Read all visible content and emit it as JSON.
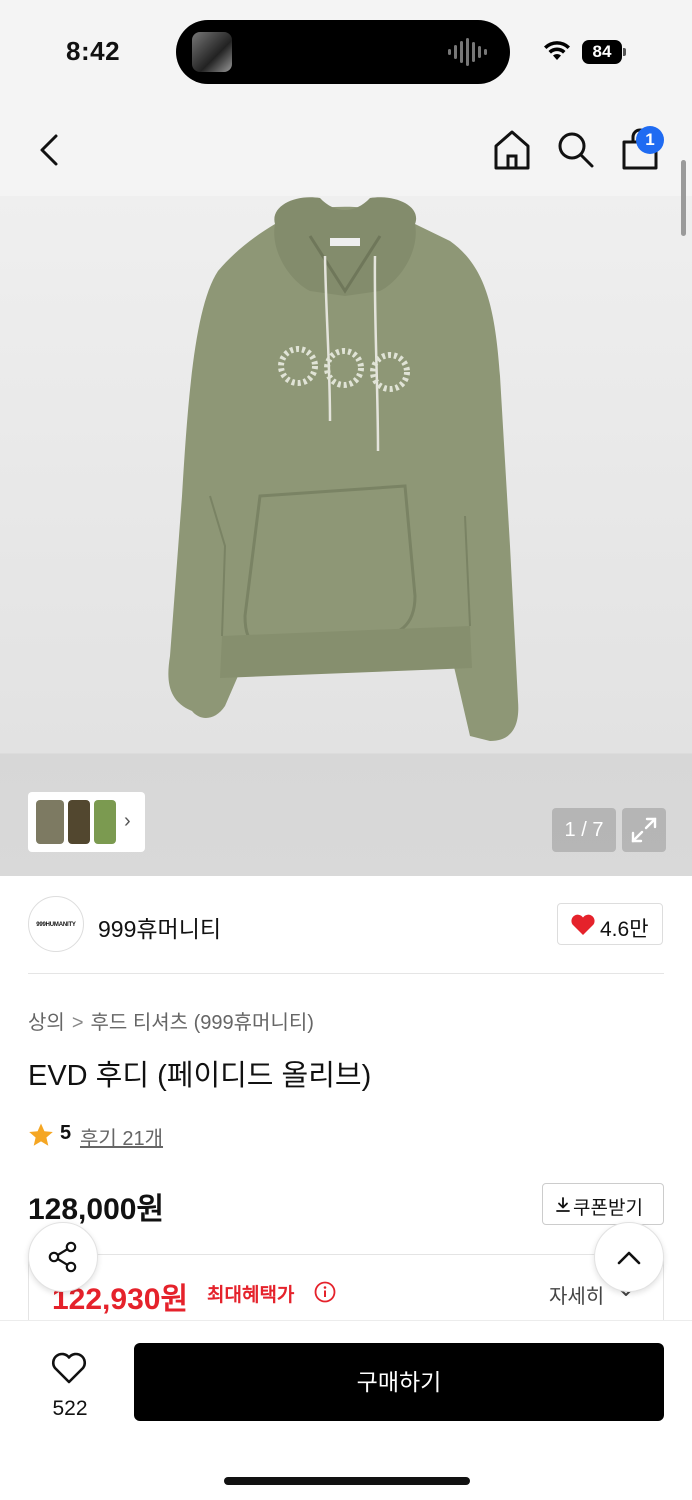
{
  "status_bar": {
    "time": "8:42",
    "battery": "84"
  },
  "nav": {
    "cart_badge": "1",
    "icons": [
      "back-arrow-icon",
      "home-icon",
      "search-icon",
      "shopping-bag-icon"
    ]
  },
  "gallery": {
    "counter": "1 / 7",
    "thumbnail_arrow": "›"
  },
  "brand": {
    "logo_text": "999HUMANITY",
    "name": "999휴머니티",
    "like_count": "4.6만"
  },
  "product": {
    "breadcrumb": [
      "상의",
      "후드 티셔츠 (999휴머니티)"
    ],
    "breadcrumb_separator": ">",
    "title": "EVD 후디 (페이디드 올리브)",
    "rating": "5",
    "review_link": "후기 21개",
    "original_price": "128,000원",
    "coupon_label": "쿠폰받기",
    "sale_price": "122,930원",
    "benefit_label": "최대혜택가",
    "detail_link": "자세히"
  },
  "bottom_bar": {
    "wish_count": "522",
    "buy_label": "구매하기"
  },
  "colors": {
    "accent_red": "#e5222b",
    "badge_blue": "#1f6bf2",
    "star_orange": "#f5a623",
    "hoodie_olive": "#8e9776"
  }
}
